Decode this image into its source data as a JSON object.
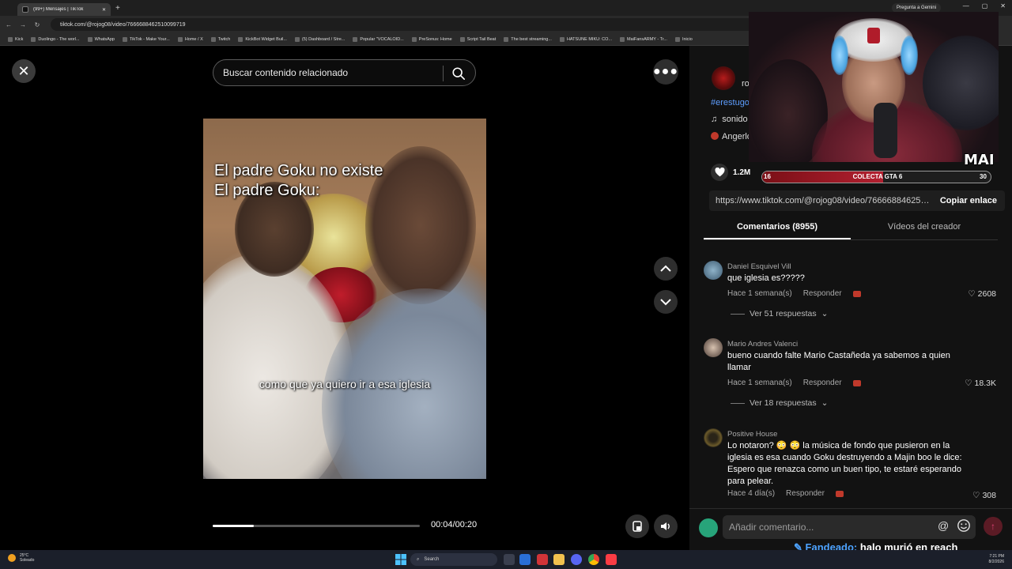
{
  "browser": {
    "tab_title": "(99+) Mensajes | TikTok",
    "new_tab_glyph": "+",
    "url": "tiktok.com/@rojog08/video/7666688462510099719",
    "gemini_button": "Pregunta a Gemini",
    "bookmarks": [
      "Kick",
      "Duolingo - The worl...",
      "WhatsApp",
      "TikTok - Make Your...",
      "Home / X",
      "Twitch",
      "KickBot Widget Buil...",
      "(5) Dashboard / Stre...",
      "Popular \"VOCALOID...",
      "PreSonus: Home",
      "Script Tail Beat",
      "The best streaming...",
      "HATSUNE MIKU: CO...",
      "MaiFansARMY - Tr...",
      "Inicio"
    ]
  },
  "video": {
    "search_placeholder": "Buscar contenido relacionado",
    "caption_line1": "El padre Goku no existe",
    "caption_line2": "El padre Goku:",
    "caption_bottom": "como que ya quiero ir a esa iglesia",
    "time": "00:04/00:20",
    "progress_fraction": 0.2
  },
  "panel": {
    "creator_name": "ro",
    "hashtag": "#erestugo",
    "sound": "sonido",
    "tagged_user": "Angerlo",
    "likes": "1.2M",
    "link_url": "https://www.tiktok.com/@rojog08/video/7666688462510099719",
    "copy_link": "Copiar enlace",
    "tab_comments": "Comentarios (8955)",
    "tab_creator_videos": "Vídeos del creador",
    "comment_placeholder": "Añadir comentario..."
  },
  "comments": [
    {
      "user": "Daniel Esquivel Vill",
      "text": "que iglesia es?????",
      "time": "Hace 1 semana(s)",
      "reply": "Responder",
      "likes": "2608",
      "replies": "Ver 51 respuestas"
    },
    {
      "user": "Mario Andres Valenci",
      "text": "bueno cuando falte Mario Castañeda ya sabemos a quien llamar",
      "time": "Hace 1 semana(s)",
      "reply": "Responder",
      "likes": "18.3K",
      "replies": "Ver 18 respuestas"
    },
    {
      "user": "Positive House",
      "text": "Lo notaron? 😳 😳 la música de fondo que pusieron en la iglesia es esa cuando Goku destruyendo a Majin boo le dice: Espero que renazca como un buen tipo, te estaré esperando para pelear.",
      "time": "Hace 4 día(s)",
      "reply": "Responder",
      "likes": "308",
      "replies": ""
    }
  ],
  "stream_overlay": {
    "badge": "MAI",
    "goal_label": "COLECTA GTA 6",
    "goal_current": "16",
    "goal_target": "30",
    "goal_fraction": 0.53,
    "fan_label": "Fandeado:",
    "fan_message": "halo murió en reach"
  },
  "taskbar": {
    "temp": "25°C",
    "weather": "Soleado",
    "search": "Search",
    "time": "7:21 PM",
    "date": "8/2/2026"
  },
  "colors": {
    "accent_link": "#5e9eff",
    "send_button": "#5b1b25",
    "goal_fill": "#b32030"
  }
}
